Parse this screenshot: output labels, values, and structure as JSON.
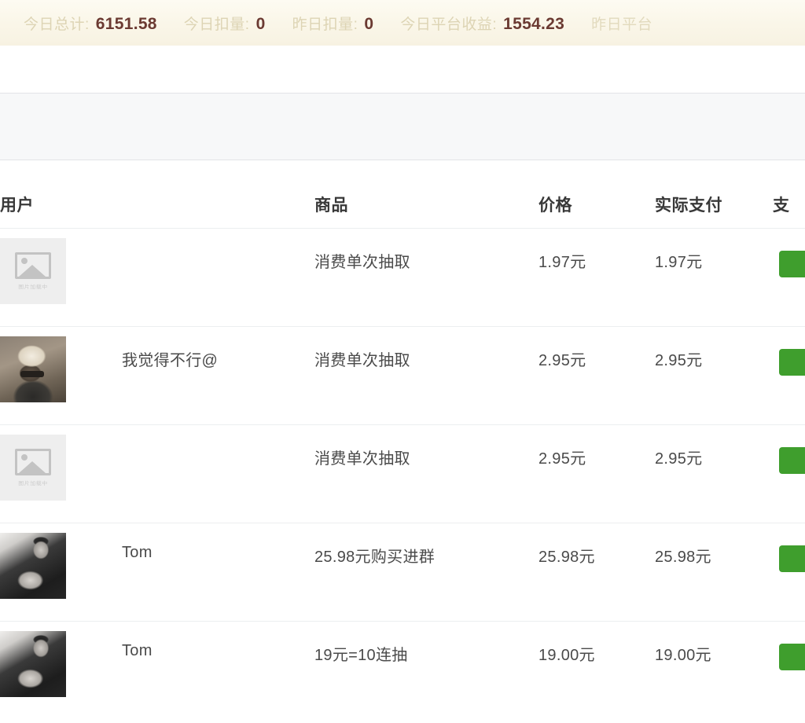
{
  "stats_bar": {
    "items": [
      {
        "label": "今日总计:",
        "value": "6151.58"
      },
      {
        "label": "今日扣量:",
        "value": "0"
      },
      {
        "label": "昨日扣量:",
        "value": "0"
      },
      {
        "label": "今日平台收益:",
        "value": "1554.23"
      },
      {
        "label": "昨日平台",
        "value": ""
      }
    ],
    "label_color": "#ddd4b4",
    "value_color": "#6b3a32",
    "background_color": "#faf6e8"
  },
  "table": {
    "columns": [
      {
        "key": "user",
        "label": "用户"
      },
      {
        "key": "name",
        "label": ""
      },
      {
        "key": "product",
        "label": "商品"
      },
      {
        "key": "price",
        "label": "价格"
      },
      {
        "key": "actual",
        "label": "实际支付"
      },
      {
        "key": "status",
        "label": "支"
      }
    ],
    "rows": [
      {
        "avatar_type": "broken-image",
        "avatar_placeholder_text": "图片加载中",
        "name": "",
        "product": "消费单次抽取",
        "price": "1.97元",
        "actual": "1.97元",
        "status_color": "#3f9e2d"
      },
      {
        "avatar_type": "photo-a",
        "avatar_placeholder_text": "",
        "name": "我觉得不行@",
        "product": "消费单次抽取",
        "price": "2.95元",
        "actual": "2.95元",
        "status_color": "#3f9e2d"
      },
      {
        "avatar_type": "broken-image",
        "avatar_placeholder_text": "图片加载中",
        "name": "",
        "product": "消费单次抽取",
        "price": "2.95元",
        "actual": "2.95元",
        "status_color": "#3f9e2d"
      },
      {
        "avatar_type": "photo-b",
        "avatar_placeholder_text": "",
        "name": "Tom",
        "product": "25.98元购买进群",
        "price": "25.98元",
        "actual": "25.98元",
        "status_color": "#3f9e2d"
      },
      {
        "avatar_type": "photo-b",
        "avatar_placeholder_text": "",
        "name": "Tom",
        "product": "19元=10连抽",
        "price": "19.00元",
        "actual": "19.00元",
        "status_color": "#3f9e2d"
      }
    ]
  }
}
